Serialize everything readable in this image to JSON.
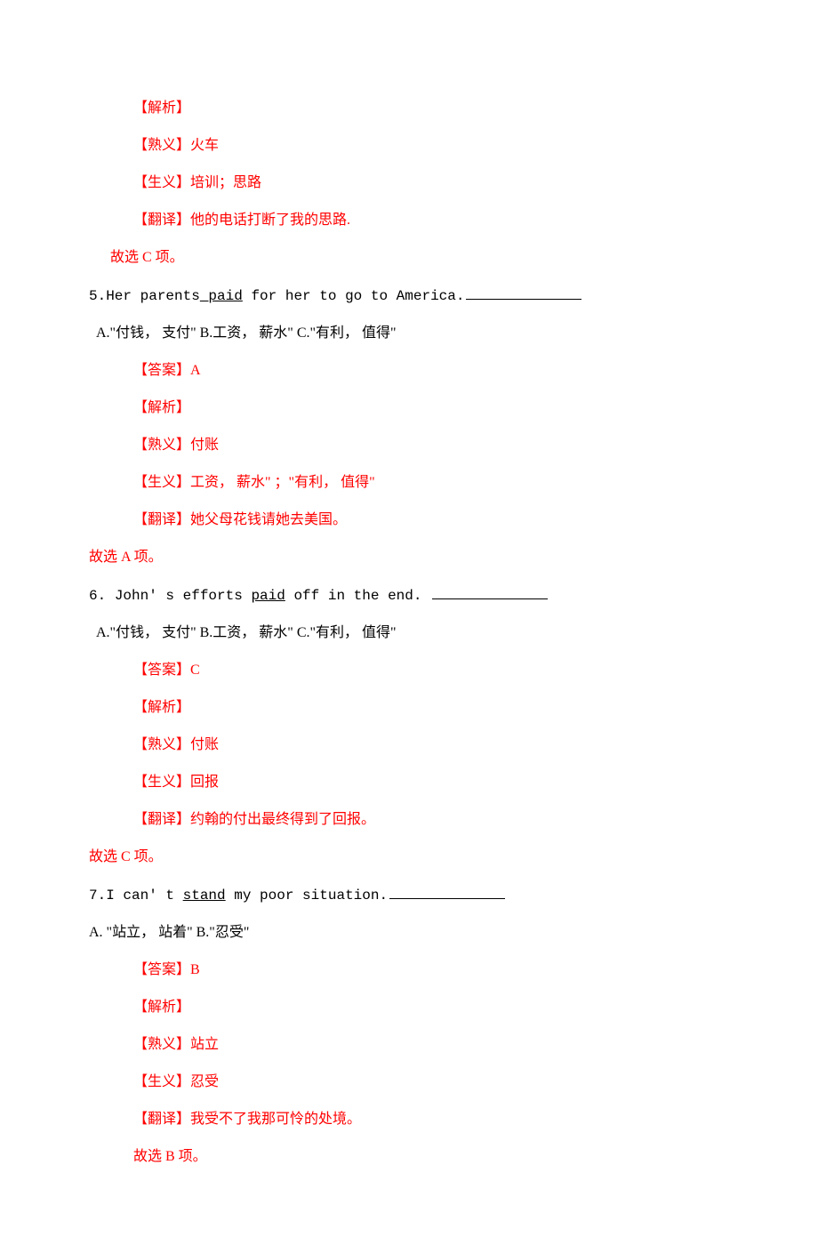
{
  "q4": {
    "l1": "【解析】",
    "l2": "【熟义】火车",
    "l3": "【生义】培训；思路",
    "l4": "【翻译】他的电话打断了我的思路.",
    "l5": "故选 C 项。"
  },
  "q5": {
    "num": "5.",
    "sent_a": "Her parents",
    "sent_u": " paid",
    "sent_b": " for her to go to America.",
    "opts": "A.\"付钱，   支付\"  B.工资，   薪水\"  C.\"有利，   值得\"",
    "ans": "【答案】A",
    "l1": "【解析】",
    "l2": "【熟义】付账",
    "l3": "【生义】工资，   薪水\"  ；\"有利，   值得\"",
    "l4": "【翻译】她父母花钱请她去美国。",
    "l5": "故选 A 项。"
  },
  "q6": {
    "num": "6.  ",
    "sent_a": "John' s efforts ",
    "sent_u": "paid",
    "sent_b": " off in the end.   ",
    "opts": "A.\"付钱，   支付\"  B.工资，   薪水\"  C.\"有利，   值得\"",
    "ans": "【答案】C",
    "l1": "【解析】",
    "l2": "【熟义】付账",
    "l3": "【生义】回报",
    "l4": "【翻译】约翰的付出最终得到了回报。",
    "l5": "故选 C 项。"
  },
  "q7": {
    "num": "7.",
    "sent_a": "I can' t ",
    "sent_u": "stand",
    "sent_b": " my poor situation.",
    "opts": "A.  \"站立，  站着\"            B.\"忍受\"",
    "ans": "【答案】B",
    "l1": "【解析】",
    "l2": "【熟义】站立",
    "l3": "【生义】忍受",
    "l4": "【翻译】我受不了我那可怜的处境。",
    "l5": "故选 B 项。"
  }
}
